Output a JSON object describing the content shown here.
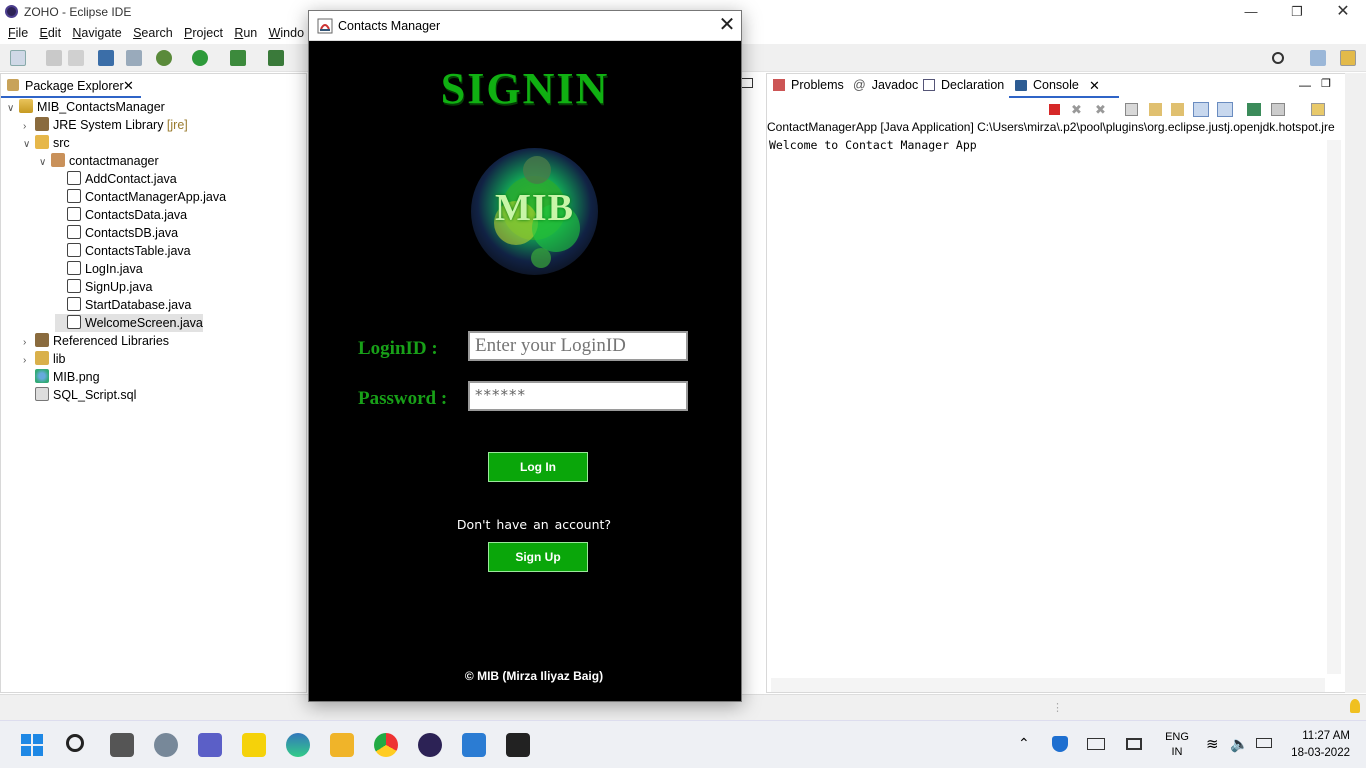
{
  "eclipse": {
    "window_title": "ZOHO - Eclipse IDE",
    "menu": [
      "File",
      "Edit",
      "Navigate",
      "Search",
      "Project",
      "Run",
      "Windo"
    ],
    "package_explorer": {
      "tab_label": "Package Explorer",
      "tree": [
        {
          "label": "MIB_ContactsManager",
          "icon": "project-icon",
          "depth": 0,
          "expanded": true
        },
        {
          "label": "JRE System Library",
          "suffix": "[jre]",
          "icon": "library-icon",
          "depth": 1,
          "expanded": false
        },
        {
          "label": "src",
          "icon": "source-folder-icon",
          "depth": 1,
          "expanded": true
        },
        {
          "label": "contactmanager",
          "icon": "package-icon",
          "depth": 2,
          "expanded": true
        },
        {
          "label": "AddContact.java",
          "icon": "java-file-icon",
          "depth": 3
        },
        {
          "label": "ContactManagerApp.java",
          "icon": "java-file-icon",
          "depth": 3
        },
        {
          "label": "ContactsData.java",
          "icon": "java-file-icon",
          "depth": 3
        },
        {
          "label": "ContactsDB.java",
          "icon": "java-file-icon",
          "depth": 3
        },
        {
          "label": "ContactsTable.java",
          "icon": "java-file-icon",
          "depth": 3
        },
        {
          "label": "LogIn.java",
          "icon": "java-file-icon",
          "depth": 3
        },
        {
          "label": "SignUp.java",
          "icon": "java-file-icon",
          "depth": 3
        },
        {
          "label": "StartDatabase.java",
          "icon": "java-file-icon",
          "depth": 3
        },
        {
          "label": "WelcomeScreen.java",
          "icon": "java-file-icon",
          "depth": 3,
          "selected": true
        },
        {
          "label": "Referenced Libraries",
          "icon": "library-icon",
          "depth": 1,
          "expanded": false
        },
        {
          "label": "lib",
          "icon": "folder-icon",
          "depth": 1,
          "expanded": false
        },
        {
          "label": "MIB.png",
          "icon": "image-file-icon",
          "depth": 1
        },
        {
          "label": "SQL_Script.sql",
          "icon": "sql-file-icon",
          "depth": 1
        }
      ]
    },
    "console": {
      "tabs": [
        "Problems",
        "Javadoc",
        "Declaration",
        "Console"
      ],
      "active_tab": "Console",
      "header": "ContactManagerApp [Java Application] C:\\Users\\mirza\\.p2\\pool\\plugins\\org.eclipse.justj.openjdk.hotspot.jre",
      "output": "Welcome to Contact Manager App"
    }
  },
  "dialog": {
    "title": "Contacts Manager",
    "heading": "SIGNIN",
    "logo_text": "MIB",
    "login_label": "LoginID :",
    "login_placeholder": "Enter your LoginID",
    "password_label": "Password :",
    "password_value": "******",
    "login_button": "Log In",
    "no_account_text": "Don't have an account?",
    "signup_button": "Sign Up",
    "copyright": "© MIB (Mirza Iliyaz Baig)",
    "colors": {
      "background": "#000000",
      "accent": "#0aa60a"
    }
  },
  "taskbar": {
    "language": "ENG",
    "region": "IN",
    "time": "11:27 AM",
    "date": "18-03-2022"
  }
}
